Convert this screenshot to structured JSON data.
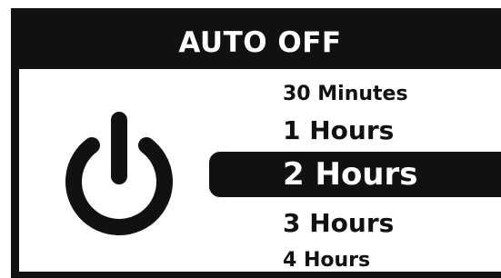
{
  "screen": {
    "title": "AUTO OFF",
    "icon": "power-icon",
    "options": [
      {
        "label": "30 Minutes",
        "selected": false
      },
      {
        "label": "1 Hours",
        "selected": false
      },
      {
        "label": "2 Hours",
        "selected": true
      },
      {
        "label": "3 Hours",
        "selected": false
      },
      {
        "label": "4 Hours",
        "selected": false
      }
    ],
    "selected_option": "2 Hours",
    "colors": {
      "foreground": "#111111",
      "background": "#ffffff",
      "highlight_text": "#ffffff"
    }
  }
}
